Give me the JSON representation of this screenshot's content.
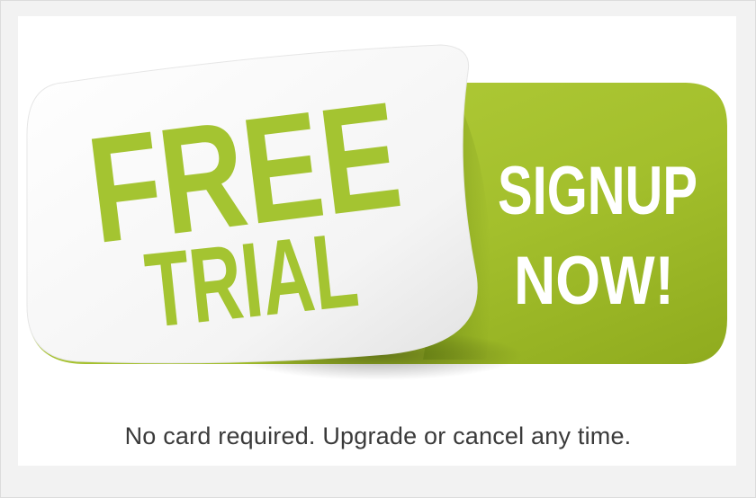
{
  "badge": {
    "sticker_line1": "FREE",
    "sticker_line2": "TRIAL",
    "button_line1": "SIGNUP",
    "button_line2": "NOW!"
  },
  "tagline": "No card required. Upgrade or cancel any time.",
  "colors": {
    "green": "#a6c22f",
    "green_dark": "#8fab1e",
    "sticker_text_green": "#a4c431",
    "white": "#ffffff"
  }
}
